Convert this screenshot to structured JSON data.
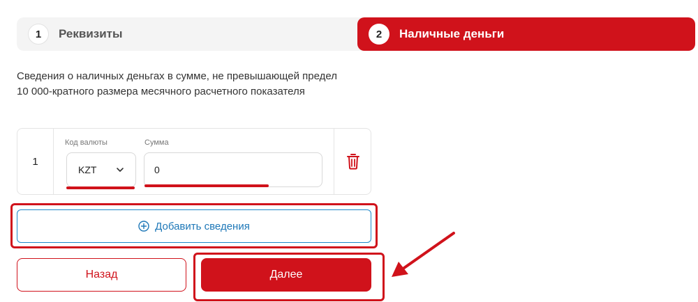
{
  "stepper": {
    "steps": [
      {
        "number": "1",
        "label": "Реквизиты",
        "state": "inactive"
      },
      {
        "number": "2",
        "label": "Наличные деньги",
        "state": "active"
      }
    ]
  },
  "description": "Сведения о наличных деньгах в сумме, не превышающей предел 10 000-кратного размера месячного расчетного показателя",
  "entries": [
    {
      "index": "1",
      "currency_label": "Код валюты",
      "currency_value": "KZT",
      "amount_label": "Сумма",
      "amount_value": "0"
    }
  ],
  "buttons": {
    "add_label": "Добавить сведения",
    "back_label": "Назад",
    "next_label": "Далее"
  },
  "icons": {
    "delete": "trash-icon",
    "add": "plus-circle-icon",
    "dropdown": "chevron-down-icon",
    "annotation": "arrow-icon"
  },
  "colors": {
    "accent": "#d0121b",
    "link": "#1e78b8",
    "stepper_bg": "#f4f4f4"
  }
}
